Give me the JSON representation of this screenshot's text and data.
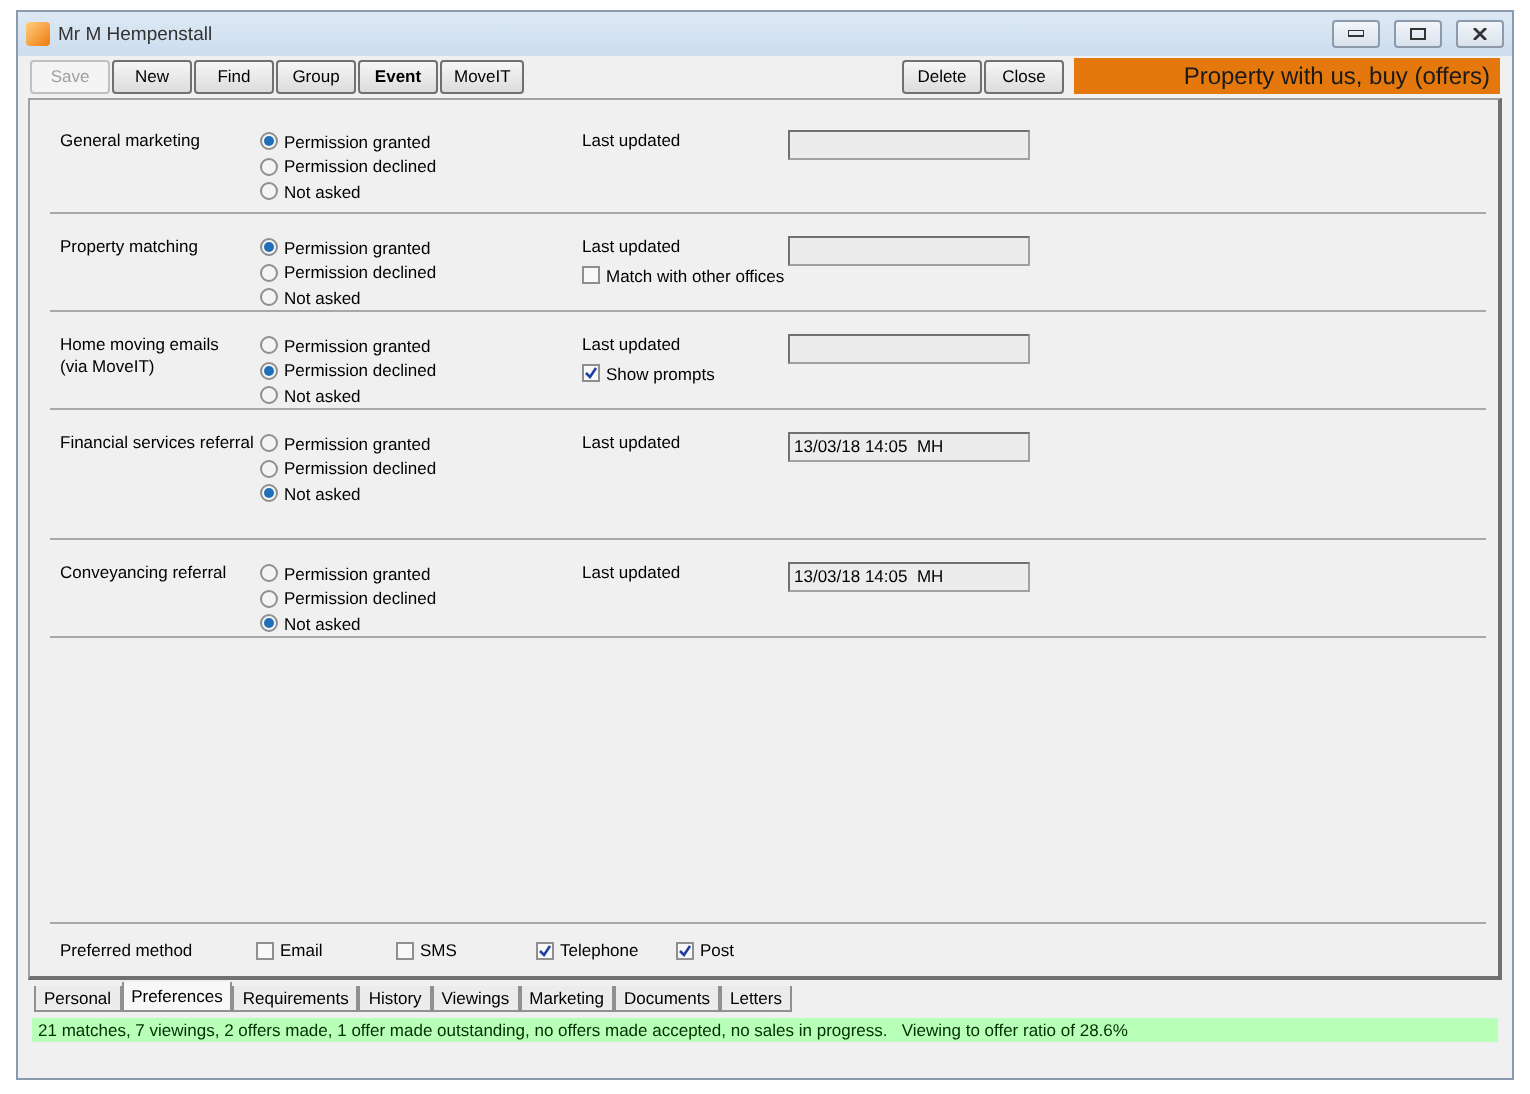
{
  "window": {
    "title": "Mr M Hempenstall"
  },
  "toolbar": {
    "left": [
      {
        "label": "Save",
        "disabled": true,
        "bold": false
      },
      {
        "label": "New",
        "disabled": false,
        "bold": false
      },
      {
        "label": "Find",
        "disabled": false,
        "bold": false
      },
      {
        "label": "Group",
        "disabled": false,
        "bold": false
      },
      {
        "label": "Event",
        "disabled": false,
        "bold": true
      },
      {
        "label": "MoveIT",
        "disabled": false,
        "bold": false
      }
    ],
    "right": [
      {
        "label": "Delete",
        "disabled": false,
        "bold": false
      },
      {
        "label": "Close",
        "disabled": false,
        "bold": false
      }
    ],
    "status_banner": "Property with us, buy (offers)"
  },
  "sections": [
    {
      "label": "General marketing",
      "options": [
        {
          "label": "Permission granted",
          "selected": true
        },
        {
          "label": "Permission declined",
          "selected": false
        },
        {
          "label": "Not asked",
          "selected": false
        }
      ],
      "updated_label": "Last updated"
    },
    {
      "label": "Property matching",
      "options": [
        {
          "label": "Permission granted",
          "selected": true
        },
        {
          "label": "Permission declined",
          "selected": false
        },
        {
          "label": "Not asked",
          "selected": false
        }
      ],
      "updated_label": "Last updated",
      "checkbox": {
        "label": "Match with other offices",
        "checked": false
      }
    },
    {
      "label": "Home moving emails\n(via MoveIT)",
      "options": [
        {
          "label": "Permission granted",
          "selected": false
        },
        {
          "label": "Permission declined",
          "selected": true
        },
        {
          "label": "Not asked",
          "selected": false
        }
      ],
      "updated_label": "Last updated",
      "checkbox": {
        "label": "Show prompts",
        "checked": true
      }
    },
    {
      "label": "Financial services referral",
      "options": [
        {
          "label": "Permission granted",
          "selected": false
        },
        {
          "label": "Permission declined",
          "selected": false
        },
        {
          "label": "Not asked",
          "selected": true
        }
      ],
      "updated_label": "Last updated",
      "updated_value": "13/03/18 14:05  MH"
    },
    {
      "label": "Conveyancing referral",
      "options": [
        {
          "label": "Permission granted",
          "selected": false
        },
        {
          "label": "Permission declined",
          "selected": false
        },
        {
          "label": "Not asked",
          "selected": true
        }
      ],
      "updated_label": "Last updated",
      "updated_value": "13/03/18 14:05  MH"
    }
  ],
  "preferred_method": {
    "label": "Preferred method",
    "options": [
      {
        "label": "Email",
        "checked": false
      },
      {
        "label": "SMS",
        "checked": false
      },
      {
        "label": "Telephone",
        "checked": true
      },
      {
        "label": "Post",
        "checked": true
      }
    ]
  },
  "tabs": [
    {
      "label": "Personal",
      "selected": false
    },
    {
      "label": "Preferences",
      "selected": true
    },
    {
      "label": "Requirements",
      "selected": false
    },
    {
      "label": "History",
      "selected": false
    },
    {
      "label": "Viewings",
      "selected": false
    },
    {
      "label": "Marketing",
      "selected": false
    },
    {
      "label": "Documents",
      "selected": false
    },
    {
      "label": "Letters",
      "selected": false
    }
  ],
  "status_bar": "21 matches, 7 viewings, 2 offers made, 1 offer made outstanding, no offers made accepted, no sales in progress.   Viewing to offer ratio of 28.6%"
}
